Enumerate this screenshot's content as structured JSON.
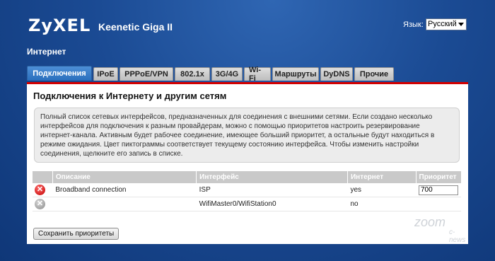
{
  "header": {
    "logo": "ZyXEL",
    "product": "Keenetic Giga II",
    "language_label": "Язык:",
    "language_value": "Русский",
    "section_title": "Интернет"
  },
  "tabs": [
    "Подключения",
    "IPoE",
    "PPPoE/VPN",
    "802.1x",
    "3G/4G",
    "Wi-Fi",
    "Маршруты",
    "DyDNS",
    "Прочие"
  ],
  "panel": {
    "title": "Подключения к Интернету и другим сетям",
    "info": "Полный список сетевых интерфейсов, предназначенных для соединения с внешними сетями. Если создано несколько интерфейсов для подключения к разным провайдерам, можно с помощью приоритетов настроить резервирование интернет-канала. Активным будет рабочее соединение, имеющее больший приоритет, а остальные будут находиться в режиме ожидания. Цвет пиктограммы соответствует текущему состоянию интерфейса. Чтобы изменить настройки соединения, щелкните его запись в списке."
  },
  "table": {
    "headers": [
      "Описание",
      "Интерфейс",
      "Интернет",
      "Приоритет"
    ],
    "rows": [
      {
        "status_icon": "red-x-icon",
        "description": "Broadband connection",
        "interface": "ISP",
        "internet": "yes",
        "priority": "700"
      },
      {
        "status_icon": "grey-x-icon",
        "description": "",
        "interface": "WifiMaster0/WifiStation0",
        "internet": "no",
        "priority": ""
      }
    ]
  },
  "buttons": {
    "save_priorities": "Сохранить приоритеты"
  },
  "watermark": {
    "main": "zoom",
    "sub": "c-news"
  },
  "colors": {
    "accent_red": "#d30000",
    "active_tab": "#2a6fbd"
  }
}
